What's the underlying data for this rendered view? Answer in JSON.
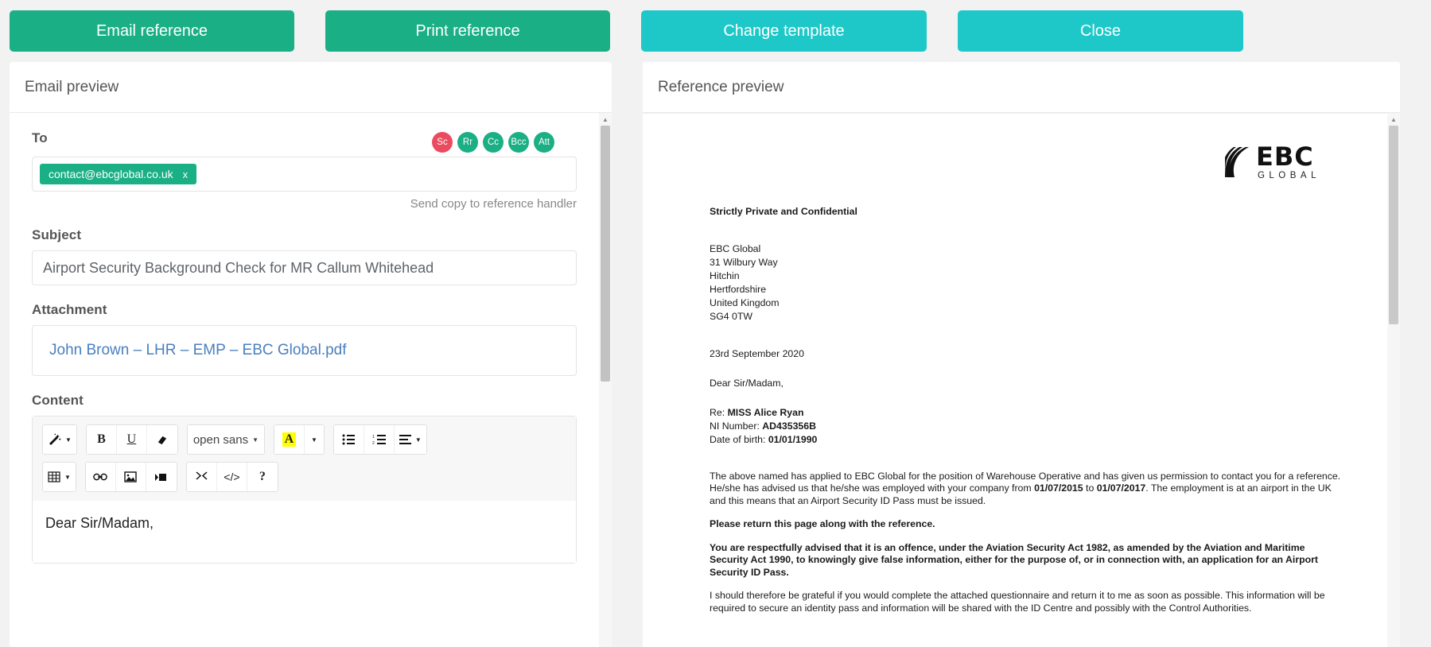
{
  "toolbar_buttons": {
    "email_reference": "Email reference",
    "print_reference": "Print reference",
    "change_template": "Change template",
    "close": "Close"
  },
  "colors": {
    "green": "#1aaf85",
    "teal": "#1fc8c8",
    "badge_red": "#ec4a5f",
    "link_blue": "#4a7fbf",
    "highlight_yellow": "#ffff00"
  },
  "left_panel": {
    "title": "Email preview",
    "to": {
      "label": "To",
      "chip": "contact@ebcglobal.co.uk",
      "chip_remove": "x",
      "send_copy": "Send copy to reference handler",
      "badges": [
        {
          "label": "Sc",
          "color": "red"
        },
        {
          "label": "Rr",
          "color": "green"
        },
        {
          "label": "Cc",
          "color": "green"
        },
        {
          "label": "Bcc",
          "color": "green"
        },
        {
          "label": "Att",
          "color": "green"
        }
      ]
    },
    "subject": {
      "label": "Subject",
      "value": "Airport Security Background Check for MR Callum Whitehead"
    },
    "attachment": {
      "label": "Attachment",
      "file": "John Brown – LHR – EMP – EBC Global.pdf"
    },
    "content": {
      "label": "Content",
      "body": "Dear Sir/Madam,",
      "toolbar_row1": [
        {
          "icon": "magic-wand-icon",
          "glyph": "✨",
          "caret": true
        },
        {
          "icon": "bold-icon",
          "glyph": "B"
        },
        {
          "icon": "underline-icon",
          "glyph": "U"
        },
        {
          "icon": "clear-format-icon",
          "glyph": "▰"
        },
        {
          "icon": "font-family-select",
          "glyph": "open sans",
          "caret": true
        },
        {
          "icon": "text-color-icon",
          "glyph": "A"
        },
        {
          "icon": "text-color-caret-icon",
          "glyph": "",
          "caret": true
        },
        {
          "icon": "bullet-list-icon",
          "glyph": "☰"
        },
        {
          "icon": "numbered-list-icon",
          "glyph": "☷"
        },
        {
          "icon": "align-icon",
          "glyph": "≡",
          "caret": true
        }
      ],
      "toolbar_row2": [
        {
          "icon": "table-icon",
          "glyph": "▦",
          "caret": true
        },
        {
          "icon": "link-icon",
          "glyph": "🔗"
        },
        {
          "icon": "image-icon",
          "glyph": "🖼"
        },
        {
          "icon": "video-icon",
          "glyph": "▶▌"
        },
        {
          "icon": "fullscreen-icon",
          "glyph": "⤢"
        },
        {
          "icon": "code-view-icon",
          "glyph": "</>"
        },
        {
          "icon": "help-icon",
          "glyph": "?"
        }
      ],
      "font_family_value": "open sans"
    }
  },
  "right_panel": {
    "title": "Reference preview",
    "logo": {
      "main": "EBC",
      "sub": "GLOBAL"
    },
    "document": {
      "confidential": "Strictly Private and Confidential",
      "sender_address": [
        "EBC Global",
        "31 Wilbury Way",
        "Hitchin",
        "Hertfordshire",
        "United Kingdom",
        "SG4 0TW"
      ],
      "date": "23rd September 2020",
      "salutation": "Dear Sir/Madam,",
      "re_label": "Re: ",
      "re_value": "MISS Alice Ryan",
      "ni_label": "NI Number: ",
      "ni_value": "AD435356B",
      "dob_label": "Date of birth: ",
      "dob_value": "01/01/1990",
      "para1_a": "The above named has applied to EBC Global for the position of Warehouse Operative and has given us permission to contact you for a reference. He/she has advised us that he/she was employed with your company from ",
      "para1_date_from": "01/07/2015",
      "para1_b": " to ",
      "para1_date_to": "01/07/2017",
      "para1_c": ". The employment is at an airport in the UK and this means that an Airport Security ID Pass must be issued.",
      "para2": "Please return this page along with the reference.",
      "para3": "You are respectfully advised that it is an offence, under the Aviation Security Act 1982, as amended by the Aviation and Maritime Security Act 1990, to knowingly give false information, either for the purpose of, or in connection with, an application for an Airport Security ID Pass.",
      "para4": "I should therefore be grateful if you would complete the attached questionnaire and return it to me as soon as possible. This information will be required to secure an identity pass and information will be shared with the ID Centre and possibly with the Control Authorities."
    }
  }
}
